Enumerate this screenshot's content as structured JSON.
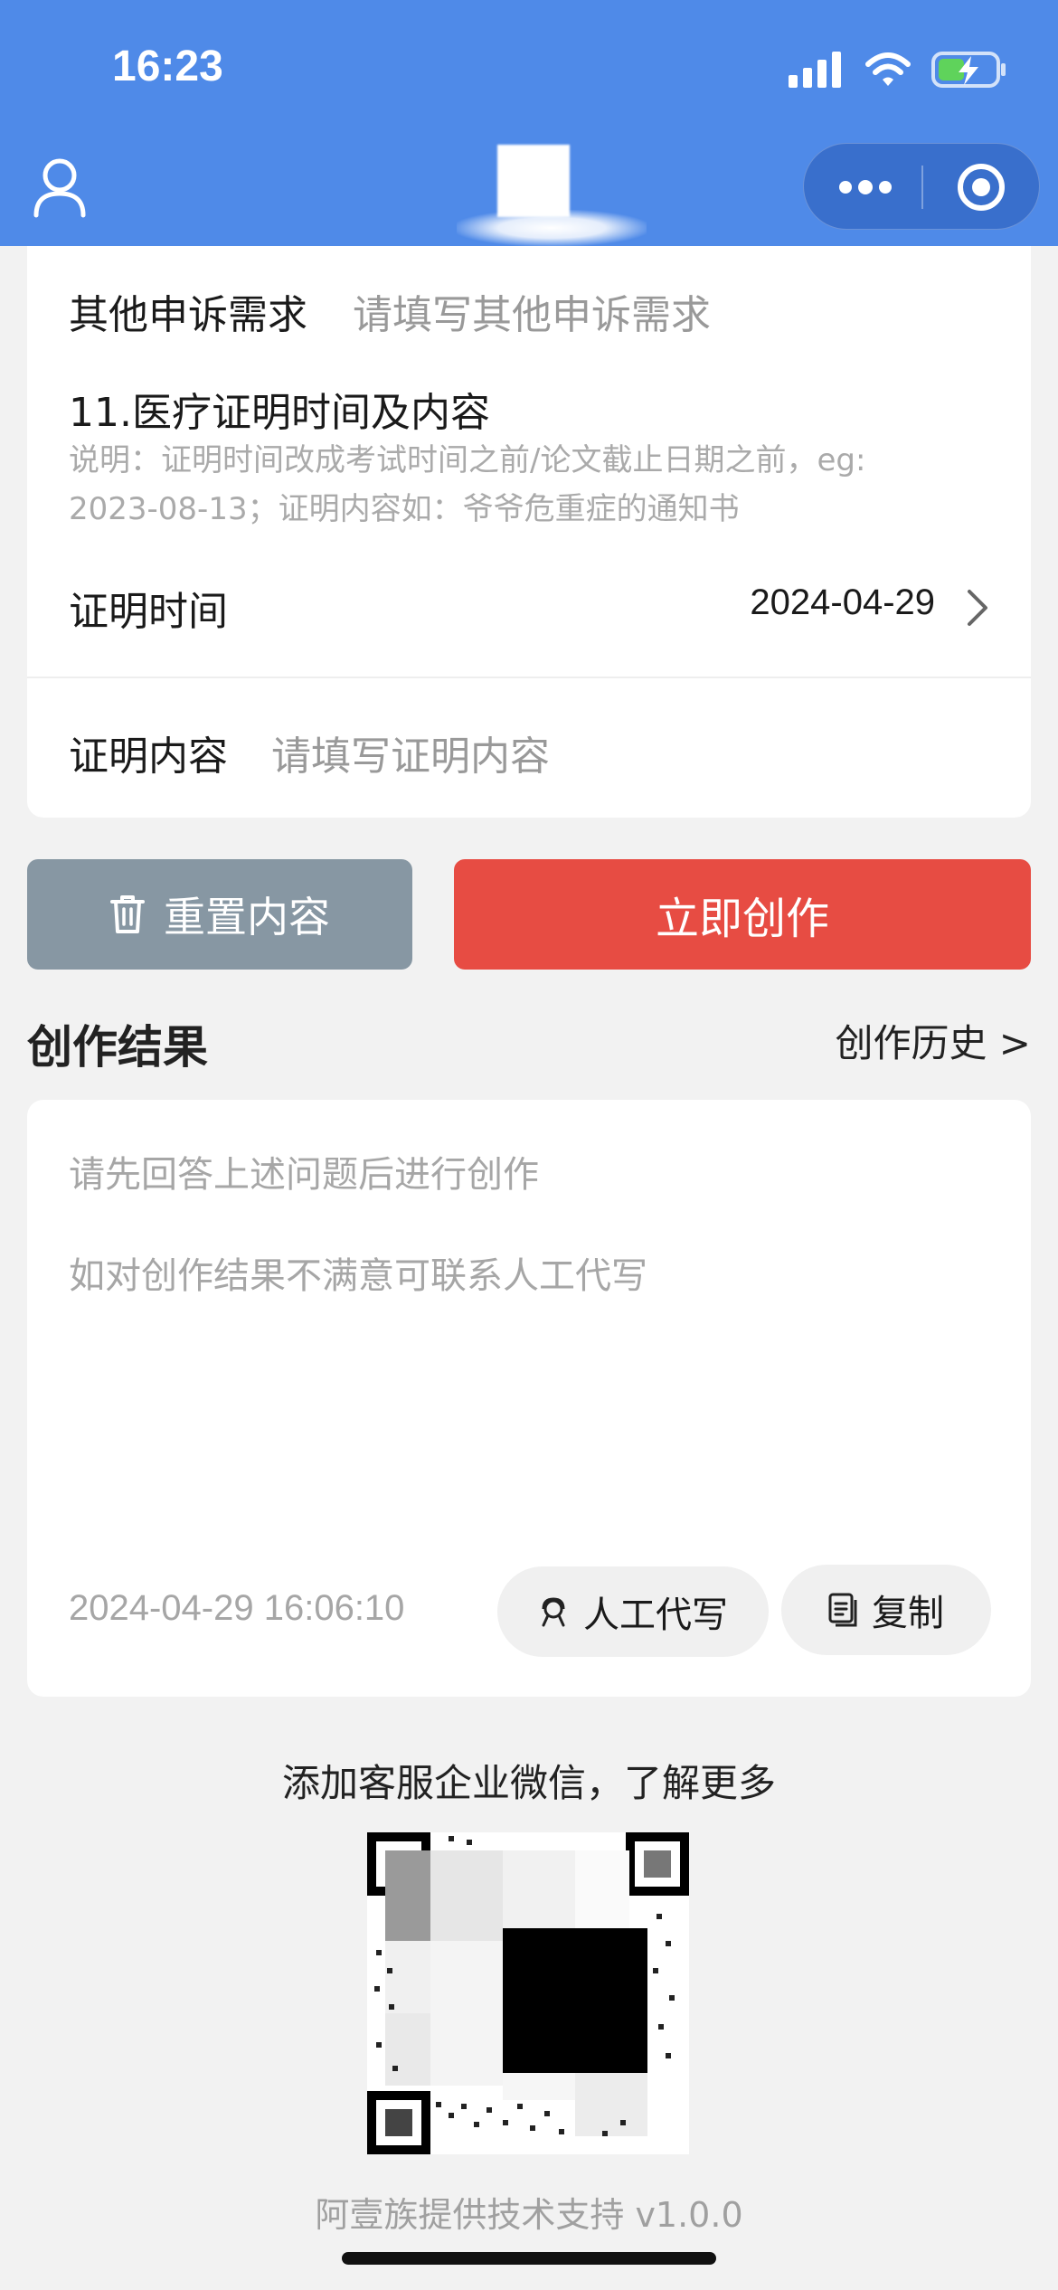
{
  "status_bar": {
    "time": "16:23"
  },
  "form": {
    "other_appeal": {
      "label": "其他申诉需求",
      "placeholder": "请填写其他申诉需求"
    },
    "section11": {
      "title": "11.医疗证明时间及内容",
      "note_line1": "说明：证明时间改成考试时间之前/论文截止日期之前，eg:",
      "note_line2": "2023-08-13；证明内容如：爷爷危重症的通知书"
    },
    "proof_time": {
      "label": "证明时间",
      "value": "2024-04-29"
    },
    "proof_content": {
      "label": "证明内容",
      "placeholder": "请填写证明内容"
    }
  },
  "actions": {
    "reset_label": "重置内容",
    "create_label": "立即创作"
  },
  "result": {
    "title": "创作结果",
    "history_link": "创作历史 >",
    "line1": "请先回答上述问题后进行创作",
    "line2": "如对创作结果不满意可联系人工代写",
    "timestamp": "2024-04-29 16:06:10",
    "human_write_label": "人工代写",
    "copy_label": "复制"
  },
  "footer": {
    "contact_text": "添加客服企业微信，了解更多",
    "support_text": "阿壹族提供技术支持 v1.0.0"
  },
  "colors": {
    "header_bg": "#4f8ae8",
    "reset_bg": "#8797a3",
    "create_bg": "#e74c43",
    "page_bg": "#f2f2f2"
  },
  "icons": [
    "user-icon",
    "more-icon",
    "target-icon",
    "chevron-right-icon",
    "trash-icon",
    "person-headset-icon",
    "copy-icon",
    "signal-icon",
    "wifi-icon",
    "battery-icon"
  ]
}
